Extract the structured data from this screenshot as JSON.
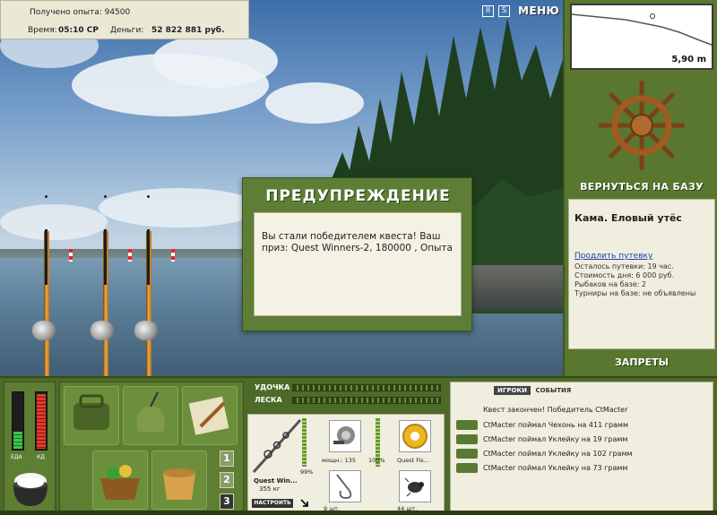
{
  "header": {
    "experience_text": "Получено опыта: 94500",
    "time_label": "Время:",
    "time_value": "05:10 СР",
    "money_label": "Деньги:",
    "money_value": "52 822 881 руб.",
    "pause_label": "II",
    "sound_label": "S",
    "menu_label": "МЕНЮ"
  },
  "depth": {
    "value": "5,90 m"
  },
  "base": {
    "return_label": "ВЕРНУТЬСЯ НА БАЗУ",
    "name": "Кама. Еловый утёс",
    "extend_link": "Продлить путевку",
    "permit_left": "Осталось путевки: 19 час.",
    "day_cost": "Стоимость дня: 6 000 руб.",
    "fishers": "Рыбаков на базе: 2",
    "tournaments": "Турниры на базе: не объявлены",
    "bans_label": "ЗАПРЕТЫ"
  },
  "dialog": {
    "title": "ПРЕДУПРЕЖДЕНИЕ",
    "message": "Вы стали победителем квеста! Ваш приз: Quest Winners-2, 180000 , Опыта"
  },
  "energy": {
    "food_label": "ЕДА",
    "stamina_label": "КД",
    "food_level": 0.3,
    "stamina_level": 0.95
  },
  "inventory": {
    "slot_1": "1",
    "slot_2": "2",
    "slot_3": "3"
  },
  "tackle": {
    "rod_label": "УДОЧКА",
    "line_label": "ЛЕСКА",
    "rod_name": "Quest Win...",
    "rod_weight": "355 кг",
    "setup_label": "НАСТРОИТЬ",
    "rod_percent": "99%",
    "reel_label": "мощн.: 135",
    "reel_percent": "100%",
    "line_name": "Quest Fis...",
    "hook_count": "9 шт.",
    "bait_count": "44 шт."
  },
  "chat": {
    "tab_players": "ИГРОКИ",
    "tab_events": "СОБЫТИЯ",
    "rows": [
      "Квест закончен! Победитель CtMacter",
      "CtMacter поймал Чехонь на 411 грамм",
      "CtMacter поймал Уклейку на 19 грамм",
      "CtMacter поймал Уклейку на 102 грамм",
      "CtMacter поймал Уклейку на 73 грамм"
    ]
  }
}
